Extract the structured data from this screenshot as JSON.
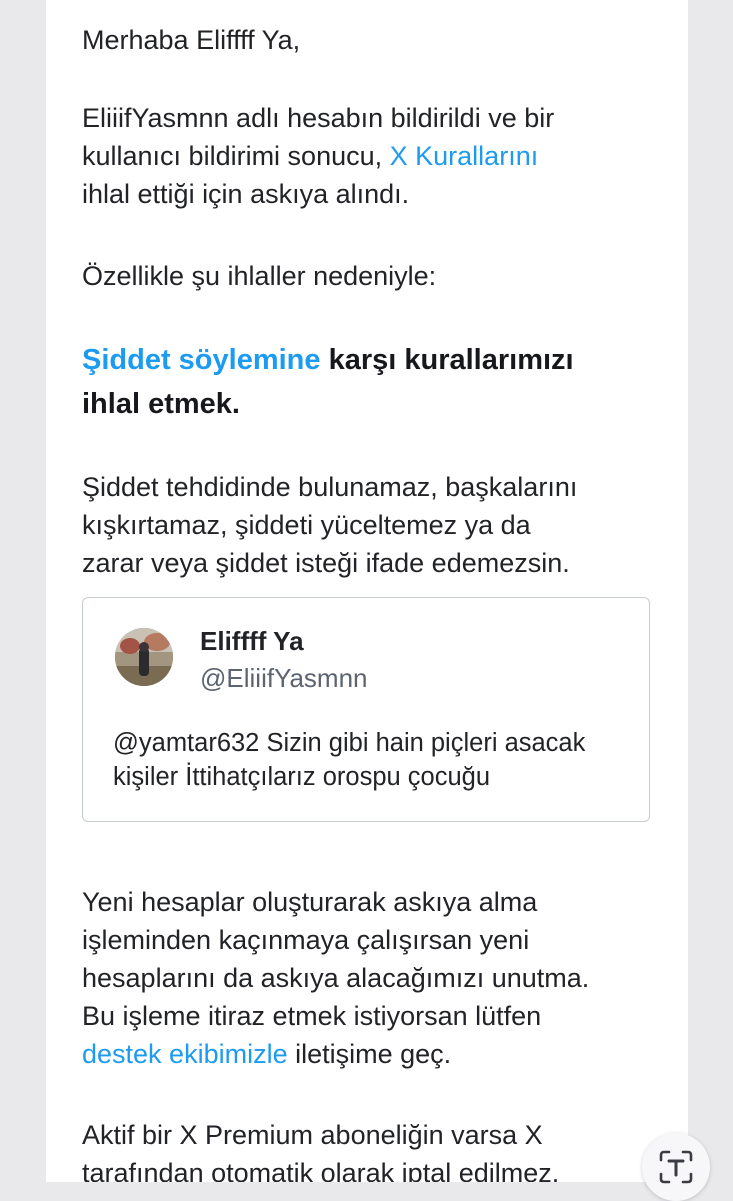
{
  "email": {
    "greeting": "Merhaba Eliffff Ya,",
    "para1": {
      "line1": "EliiifYasmnn adlı hesabın bildirildi ve bir",
      "line2_pre": "kullanıcı bildirimi sonucu, ",
      "line2_link": "X Kurallarını",
      "line3": "ihlal ettiği için askıya alındı."
    },
    "para2": "Özellikle şu ihlaller nedeniyle:",
    "violation": {
      "link": "Şiddet söylemine",
      "rest1": " karşı kurallarımızı",
      "line2": "ihlal etmek."
    },
    "para3": {
      "line1": "Şiddet tehdidinde bulunamaz, başkalarını",
      "line2": "kışkırtamaz, şiddeti yüceltemez ya da",
      "line3": "zarar veya şiddet isteği ifade edemezsin."
    },
    "tweet": {
      "name": "Eliffff Ya",
      "handle": "@EliiifYasmnn",
      "text_line1": "@yamtar632 Sizin gibi hain piçleri asacak",
      "text_line2": "kişiler İttihatçılarız orospu çocuğu"
    },
    "para4": {
      "line1": "Yeni hesaplar oluşturarak askıya alma",
      "line2": "işleminden kaçınmaya çalışırsan yeni",
      "line3": "hesaplarını da askıya alacağımızı unutma.",
      "line4": "Bu işleme itiraz etmek istiyorsan lütfen",
      "line5_link": "destek ekibimizle",
      "line5_rest": " iletişime geç."
    },
    "para5": {
      "line1": "Aktif bir X Premium aboneliğin varsa X",
      "line2": "tarafından otomatik olarak iptal edilmez."
    }
  },
  "fab": {
    "icon": "text-recognition-icon"
  },
  "colors": {
    "link": "#1d9bf0",
    "text": "#222326",
    "background": "#e9e9ec"
  }
}
